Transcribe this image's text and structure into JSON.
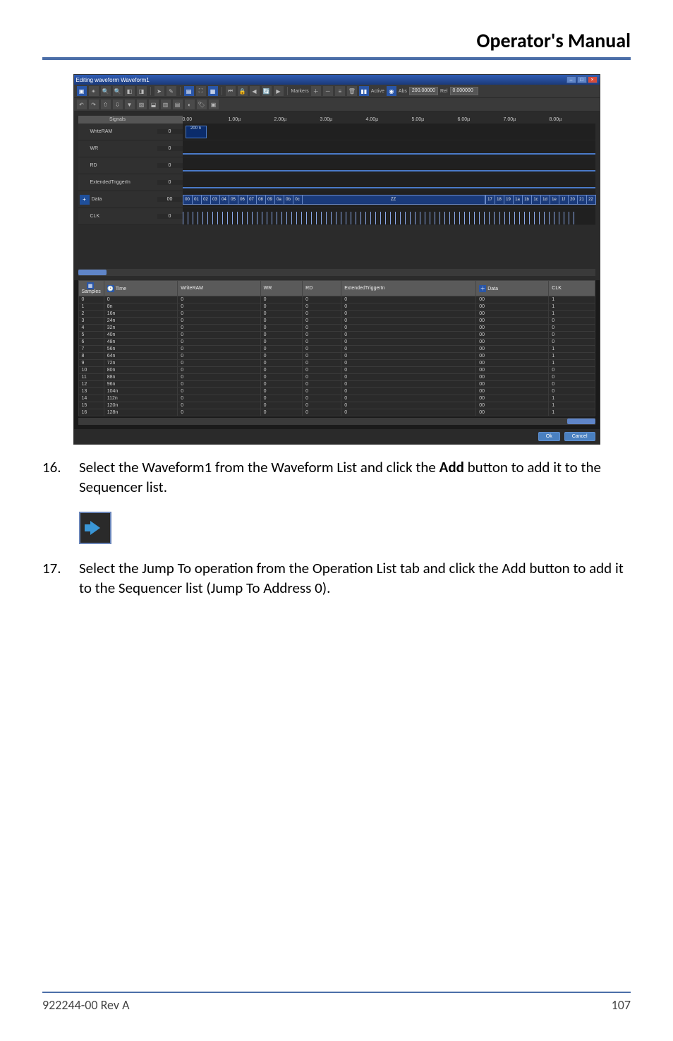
{
  "doc": {
    "header_title": "Operator's Manual",
    "footer_left": "922244-00 Rev A",
    "footer_right": "107"
  },
  "steps": {
    "s16_num": "16.",
    "s16_text_a": "Select the Waveform1 from the Waveform List and click the ",
    "s16_text_bold": "Add",
    "s16_text_b": " button to add it to the Sequencer list.",
    "s17_num": "17.",
    "s17_text": "Select the Jump To operation from the Operation List tab and click the Add button to add it to the Sequencer list (Jump To Address 0)."
  },
  "win": {
    "title": "Editing waveform Waveform1",
    "min": "–",
    "max": "□",
    "close": "×",
    "buttons": {
      "ok": "Ok",
      "cancel": "Cancel"
    }
  },
  "toolbar": {
    "markers_label": "Markers",
    "active_label": "Active",
    "abs_label": "Abs",
    "rel_label": "Rel",
    "abs_value": "200.00000",
    "rel_value": "0.000000"
  },
  "ruler": {
    "ticks": [
      "0.00",
      "1.00µ",
      "2.00µ",
      "3.00µ",
      "4.00µ",
      "5.00µ",
      "6.00µ",
      "7.00µ",
      "8.00µ"
    ]
  },
  "signals_header": "Signals",
  "signals": [
    {
      "name": "WriteRAM",
      "value": "0",
      "style": "pulse"
    },
    {
      "name": "WR",
      "value": "0",
      "style": "low"
    },
    {
      "name": "RD",
      "value": "0",
      "style": "low"
    },
    {
      "name": "ExtendedTriggerIn",
      "value": "0",
      "style": "low"
    },
    {
      "name": "Data",
      "value": "00",
      "style": "bus",
      "expand": true
    },
    {
      "name": "CLK",
      "value": "0",
      "style": "clk"
    }
  ],
  "bus": {
    "left": [
      "00",
      "01",
      "02",
      "03",
      "04",
      "05",
      "06",
      "07",
      "08",
      "09",
      "0a",
      "0b",
      "0c"
    ],
    "mid": "ZZ",
    "right": [
      "17",
      "18",
      "19",
      "1a",
      "1b",
      "1c",
      "1d",
      "1e",
      "1f",
      "20",
      "21",
      "22"
    ]
  },
  "table": {
    "headers": {
      "samples": "Samples",
      "time": "Time",
      "writeram": "WriteRAM",
      "wr": "WR",
      "rd": "RD",
      "ext": "ExtendedTriggerIn",
      "data": "Data",
      "clk": "CLK"
    },
    "rows": [
      {
        "s": "0",
        "t": "0",
        "wram": "0",
        "wr": "0",
        "rd": "0",
        "ext": "0",
        "data": "00",
        "clk": "1"
      },
      {
        "s": "1",
        "t": "8n",
        "wram": "0",
        "wr": "0",
        "rd": "0",
        "ext": "0",
        "data": "00",
        "clk": "1"
      },
      {
        "s": "2",
        "t": "16n",
        "wram": "0",
        "wr": "0",
        "rd": "0",
        "ext": "0",
        "data": "00",
        "clk": "1"
      },
      {
        "s": "3",
        "t": "24n",
        "wram": "0",
        "wr": "0",
        "rd": "0",
        "ext": "0",
        "data": "00",
        "clk": "0"
      },
      {
        "s": "4",
        "t": "32n",
        "wram": "0",
        "wr": "0",
        "rd": "0",
        "ext": "0",
        "data": "00",
        "clk": "0"
      },
      {
        "s": "5",
        "t": "40n",
        "wram": "0",
        "wr": "0",
        "rd": "0",
        "ext": "0",
        "data": "00",
        "clk": "0"
      },
      {
        "s": "6",
        "t": "48n",
        "wram": "0",
        "wr": "0",
        "rd": "0",
        "ext": "0",
        "data": "00",
        "clk": "0"
      },
      {
        "s": "7",
        "t": "56n",
        "wram": "0",
        "wr": "0",
        "rd": "0",
        "ext": "0",
        "data": "00",
        "clk": "1"
      },
      {
        "s": "8",
        "t": "64n",
        "wram": "0",
        "wr": "0",
        "rd": "0",
        "ext": "0",
        "data": "00",
        "clk": "1"
      },
      {
        "s": "9",
        "t": "72n",
        "wram": "0",
        "wr": "0",
        "rd": "0",
        "ext": "0",
        "data": "00",
        "clk": "1"
      },
      {
        "s": "10",
        "t": "80n",
        "wram": "0",
        "wr": "0",
        "rd": "0",
        "ext": "0",
        "data": "00",
        "clk": "0"
      },
      {
        "s": "11",
        "t": "88n",
        "wram": "0",
        "wr": "0",
        "rd": "0",
        "ext": "0",
        "data": "00",
        "clk": "0"
      },
      {
        "s": "12",
        "t": "96n",
        "wram": "0",
        "wr": "0",
        "rd": "0",
        "ext": "0",
        "data": "00",
        "clk": "0"
      },
      {
        "s": "13",
        "t": "104n",
        "wram": "0",
        "wr": "0",
        "rd": "0",
        "ext": "0",
        "data": "00",
        "clk": "0"
      },
      {
        "s": "14",
        "t": "112n",
        "wram": "0",
        "wr": "0",
        "rd": "0",
        "ext": "0",
        "data": "00",
        "clk": "1"
      },
      {
        "s": "15",
        "t": "120n",
        "wram": "0",
        "wr": "0",
        "rd": "0",
        "ext": "0",
        "data": "00",
        "clk": "1"
      },
      {
        "s": "16",
        "t": "128n",
        "wram": "0",
        "wr": "0",
        "rd": "0",
        "ext": "0",
        "data": "00",
        "clk": "1"
      }
    ]
  },
  "pulse_label": "200 n"
}
